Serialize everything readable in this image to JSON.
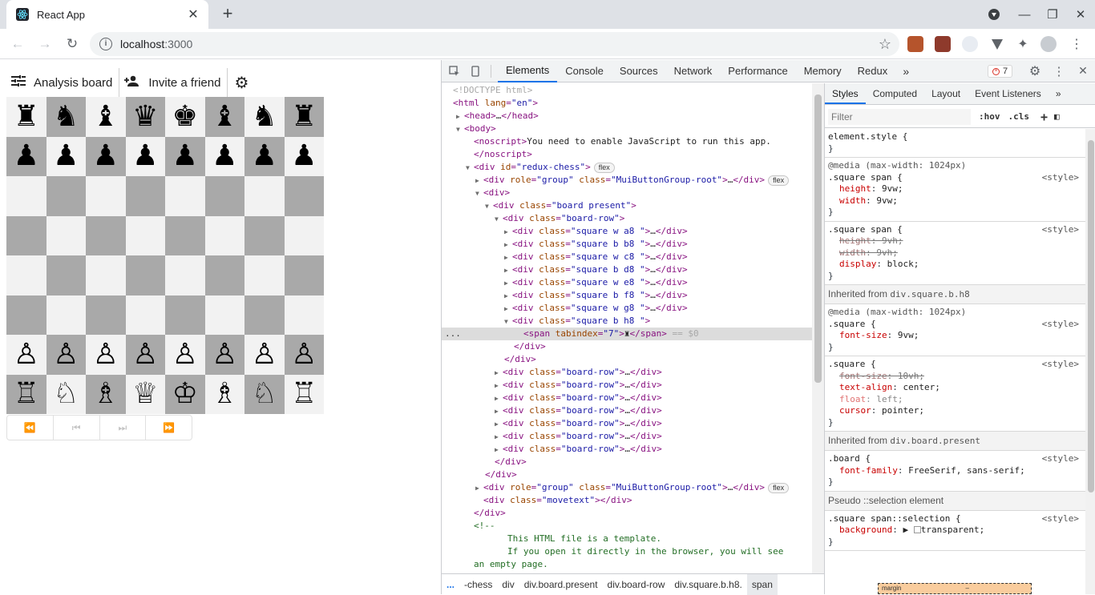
{
  "browser": {
    "tab_title": "React App",
    "url_host": "localhost",
    "url_port": ":3000"
  },
  "app": {
    "analysis_label": "Analysis board",
    "invite_label": "Invite a friend",
    "board": [
      [
        "♜",
        "♞",
        "♝",
        "♛",
        "♚",
        "♝",
        "♞",
        "♜"
      ],
      [
        "♟",
        "♟",
        "♟",
        "♟",
        "♟",
        "♟",
        "♟",
        "♟"
      ],
      [
        "",
        "",
        "",
        "",
        "",
        "",
        "",
        ""
      ],
      [
        "",
        "",
        "",
        "",
        "",
        "",
        "",
        ""
      ],
      [
        "",
        "",
        "",
        "",
        "",
        "",
        "",
        ""
      ],
      [
        "",
        "",
        "",
        "",
        "",
        "",
        "",
        ""
      ],
      [
        "♙",
        "♙",
        "♙",
        "♙",
        "♙",
        "♙",
        "♙",
        "♙"
      ],
      [
        "♖",
        "♘",
        "♗",
        "♕",
        "♔",
        "♗",
        "♘",
        "♖"
      ]
    ],
    "nav_buttons": [
      "⏪",
      "⏮",
      "⏭",
      "⏩"
    ]
  },
  "devtools": {
    "tabs": [
      "Elements",
      "Console",
      "Sources",
      "Network",
      "Performance",
      "Memory",
      "Redux"
    ],
    "error_count": "7",
    "breadcrumbs": [
      "-chess",
      "div",
      "div.board.present",
      "div.board-row",
      "div.square.b.h8.",
      "span"
    ],
    "styles_tabs": [
      "Styles",
      "Computed",
      "Layout",
      "Event Listeners"
    ],
    "filter_placeholder": "Filter",
    "hov": ":hov",
    "cls": ".cls",
    "box_label": "margin",
    "box_value": "–"
  }
}
